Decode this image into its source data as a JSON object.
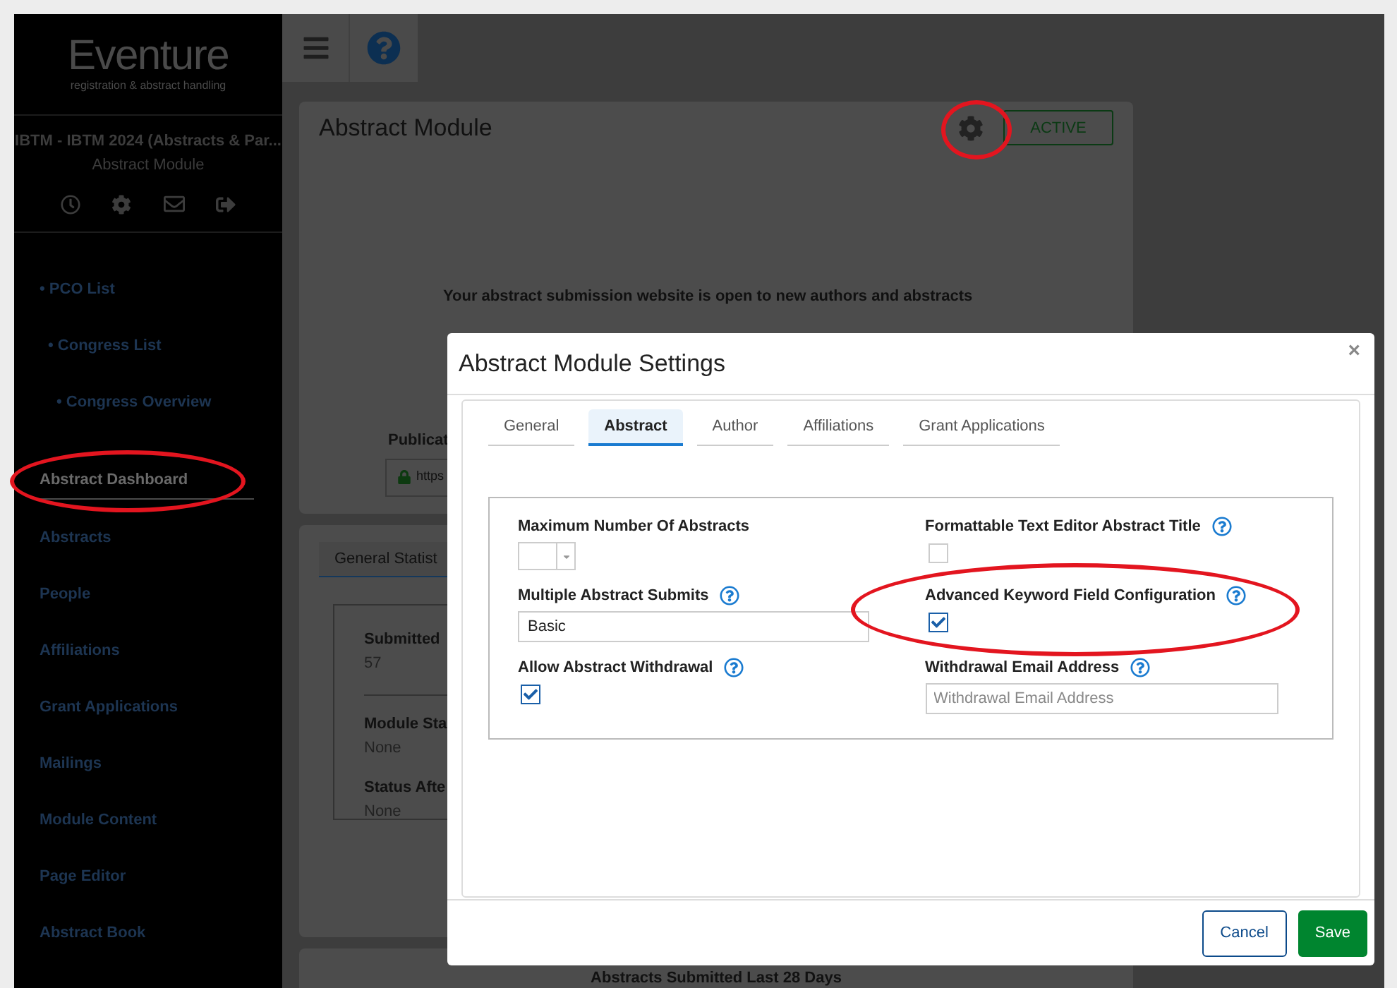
{
  "logo": {
    "name": "Eventure",
    "tagline": "registration & abstract handling"
  },
  "sidebar": {
    "event_title": "IBTM - IBTM 2024 (Abstracts & Par...",
    "module": "Abstract Module",
    "breadcrumbs": [
      {
        "label": "• PCO List",
        "children": [
          {
            "label": "• Congress List",
            "children": [
              {
                "label": "• Congress Overview"
              }
            ]
          }
        ]
      }
    ],
    "items": [
      {
        "label": "Abstract Dashboard",
        "selected": true
      },
      {
        "label": "Abstracts",
        "selected": false
      },
      {
        "label": "People",
        "selected": false
      },
      {
        "label": "Affiliations",
        "selected": false
      },
      {
        "label": "Grant Applications",
        "selected": false
      },
      {
        "label": "Mailings",
        "selected": false
      },
      {
        "label": "Module Content",
        "selected": false
      },
      {
        "label": "Page Editor",
        "selected": false
      },
      {
        "label": "Abstract Book",
        "selected": false
      }
    ]
  },
  "module_card": {
    "title": "Abstract Module",
    "status": "ACTIVE",
    "message": "Your abstract submission website is open to new authors and abstracts",
    "publication_label": "Publicat",
    "url": "https"
  },
  "stats_card": {
    "tabs": [
      {
        "label": "General Statist",
        "selected": true
      }
    ],
    "stats": [
      {
        "label": "Submitted",
        "value": "57"
      },
      {
        "label": "Module Sta",
        "value": "None"
      },
      {
        "label": "Status Afte",
        "value": "None"
      }
    ]
  },
  "chart_card": {
    "title": "Abstracts Submitted Last 28 Days"
  },
  "dialog": {
    "title": "Abstract Module Settings",
    "close": "×",
    "tabs": [
      {
        "label": "General",
        "selected": false
      },
      {
        "label": "Abstract",
        "selected": true
      },
      {
        "label": "Author",
        "selected": false
      },
      {
        "label": "Affiliations",
        "selected": false
      },
      {
        "label": "Grant Applications",
        "selected": false
      }
    ],
    "fields": [
      {
        "kind": "number",
        "label": "Maximum Number Of Abstracts",
        "help": false
      },
      {
        "kind": "checkbox",
        "label": "Formattable Text Editor Abstract Title",
        "help": true,
        "checked": false
      },
      {
        "kind": "select",
        "label": "Multiple Abstract Submits",
        "help": true,
        "value": "Basic"
      },
      {
        "kind": "checkbox",
        "label": "Advanced Keyword Field Configuration",
        "help": true,
        "checked": true
      },
      {
        "kind": "checkbox",
        "label": "Allow Abstract Withdrawal",
        "help": true,
        "checked": true
      },
      {
        "kind": "text",
        "label": "Withdrawal Email Address",
        "help": true,
        "placeholder": "Withdrawal Email Address"
      }
    ],
    "buttons": [
      {
        "label": "Cancel",
        "kind": "secondary"
      },
      {
        "label": "Save",
        "kind": "primary"
      }
    ]
  }
}
